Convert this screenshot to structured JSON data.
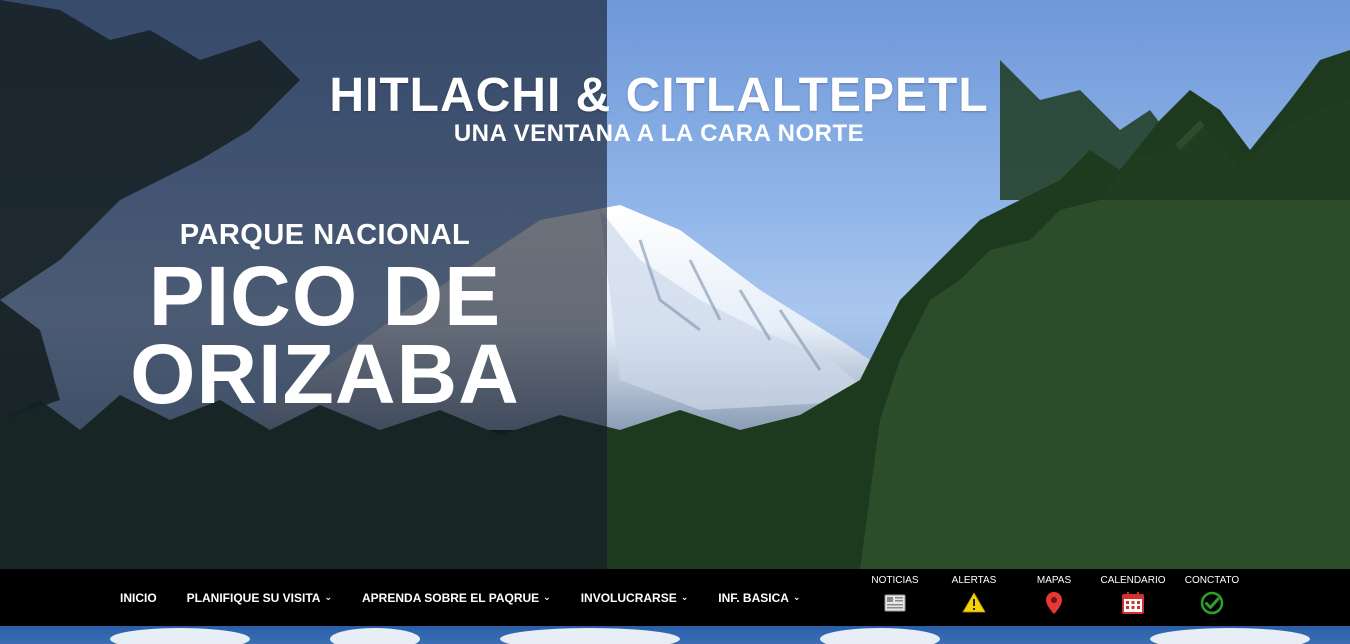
{
  "hero": {
    "title": "HITLACHI & CITLALTEPETL",
    "subtitle": "UNA VENTANA A LA CARA NORTE",
    "park_kicker": "PARQUE NACIONAL",
    "park_name_line1": "PICO DE",
    "park_name_line2": "ORIZABA"
  },
  "nav": {
    "items": [
      {
        "label": "INICIO",
        "has_dropdown": false
      },
      {
        "label": "PLANIFIQUE SU VISITA",
        "has_dropdown": true
      },
      {
        "label": "APRENDA SOBRE EL PAQRUE",
        "has_dropdown": true
      },
      {
        "label": "INVOLUCRARSE",
        "has_dropdown": true
      },
      {
        "label": "INF. BASICA",
        "has_dropdown": true
      }
    ],
    "chevron": "⌄"
  },
  "quick_links": [
    {
      "label": "NOTICIAS",
      "icon": "newspaper-icon"
    },
    {
      "label": "ALERTAS",
      "icon": "warning-icon"
    },
    {
      "label": "MAPAS",
      "icon": "map-pin-icon"
    },
    {
      "label": "CALENDARIO",
      "icon": "calendar-icon"
    },
    {
      "label": "CONCTATO",
      "icon": "check-circle-icon"
    }
  ],
  "colors": {
    "navbar_bg": "#000000",
    "alert_yellow": "#f5d20a",
    "map_pin_red": "#e53935",
    "calendar_red": "#d32f2f",
    "contact_green": "#2e9e2e"
  }
}
